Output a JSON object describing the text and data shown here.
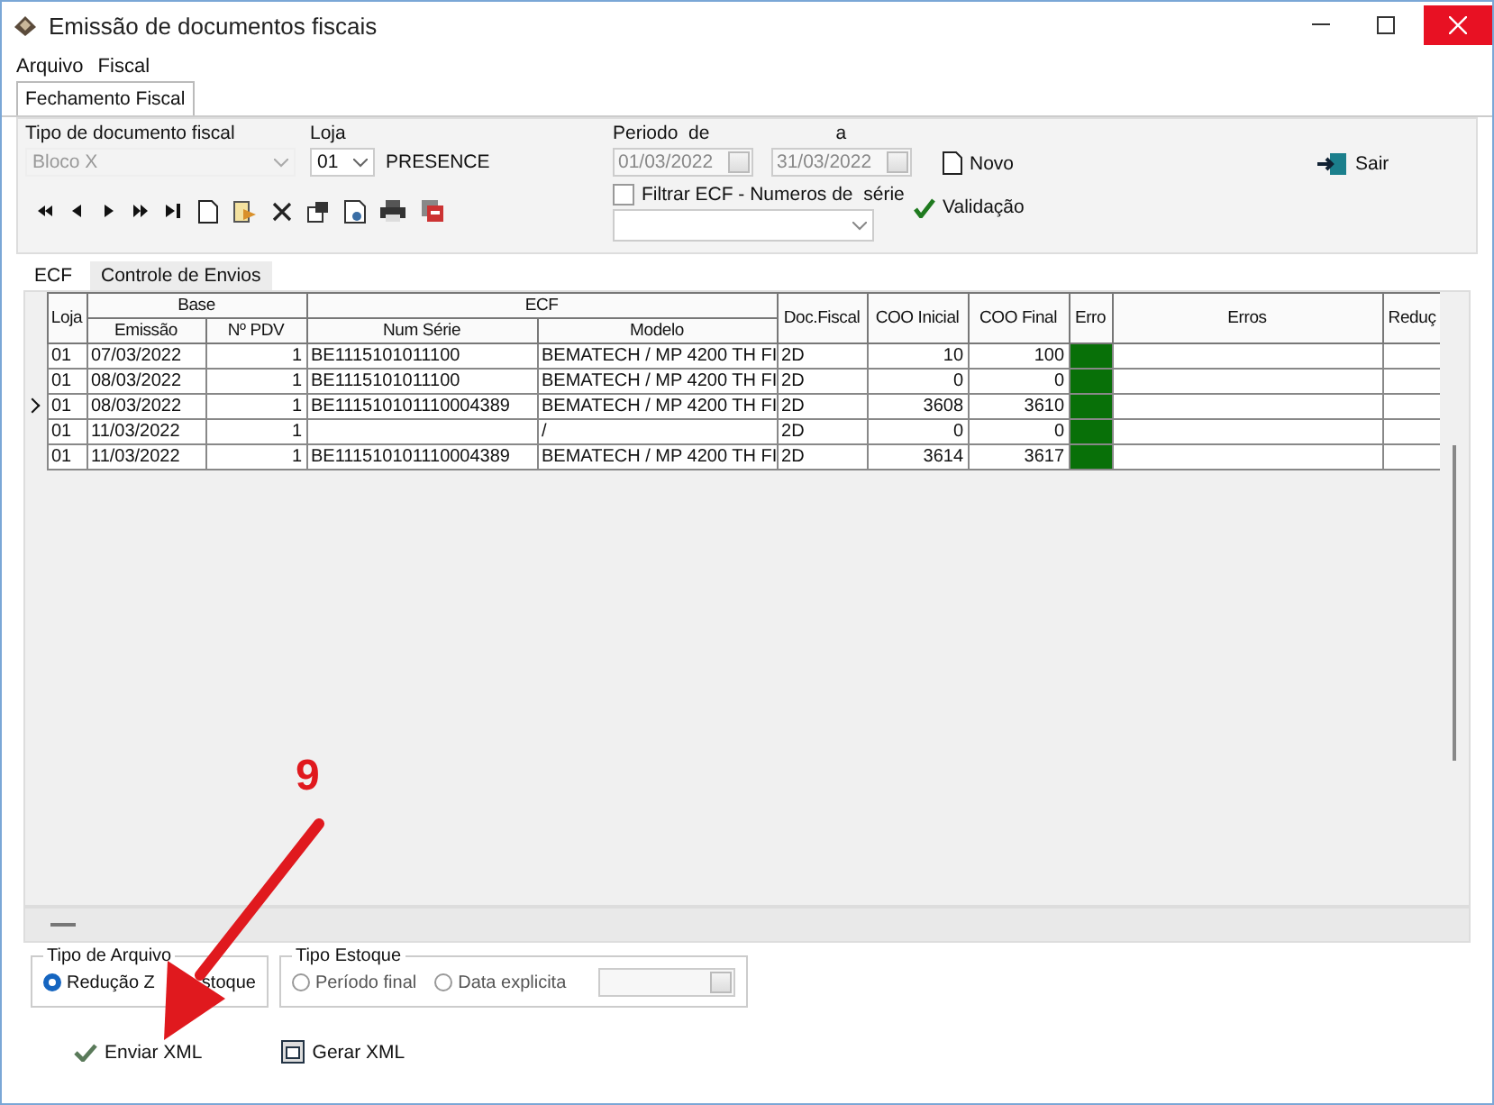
{
  "window": {
    "title": "Emissão de documentos fiscais"
  },
  "menu": [
    "Arquivo",
    "Fiscal"
  ],
  "top_tabs": [
    {
      "label": "Fechamento Fiscal",
      "selected": true
    }
  ],
  "filters": {
    "tipo_label": "Tipo de documento fiscal",
    "tipo_value": "Bloco X",
    "tipo_disabled": true,
    "loja_label": "Loja",
    "loja_value": "01",
    "loja_name": "PRESENCE",
    "periodo_label": "Periodo  de",
    "periodo_from": "01/03/2022",
    "a_label": "a",
    "periodo_to": "31/03/2022",
    "filter_label": "Filtrar ECF - Numeros de  série",
    "filter_checked": false
  },
  "actions": {
    "novo": "Novo",
    "validacao": "Validação",
    "sair": "Sair"
  },
  "tabs": [
    {
      "label": "ECF",
      "selected": true
    },
    {
      "label": "Controle de Envios",
      "selected": false
    }
  ],
  "table": {
    "groups": [
      "Base",
      "ECF"
    ],
    "columns": [
      "Loja",
      "Emissão",
      "Nº PDV",
      "Num Série",
      "Modelo",
      "Doc.Fiscal",
      "COO Inicial",
      "COO Final",
      "Erro",
      "Erros",
      "Reduç"
    ],
    "rows": [
      {
        "selected": false,
        "cells": [
          "01",
          "07/03/2022",
          "1",
          "BE1115101011100",
          "BEMATECH / MP 4200 TH FI",
          "2D",
          "10",
          "100"
        ],
        "color": "#087008"
      },
      {
        "selected": false,
        "cells": [
          "01",
          "08/03/2022",
          "1",
          "BE1115101011100",
          "BEMATECH / MP 4200 TH FI",
          "2D",
          "0",
          "0"
        ],
        "color": "#087008"
      },
      {
        "selected": true,
        "cells": [
          "01",
          "08/03/2022",
          "1",
          "BE111510101110004389",
          "BEMATECH / MP 4200 TH FI",
          "2D",
          "3608",
          "3610"
        ],
        "color": "#087008"
      },
      {
        "selected": false,
        "cells": [
          "01",
          "11/03/2022",
          "1",
          "",
          "/",
          "2D",
          "0",
          "0"
        ],
        "color": "#087008"
      },
      {
        "selected": false,
        "cells": [
          "01",
          "11/03/2022",
          "1",
          "BE111510101110004389",
          "BEMATECH / MP 4200 TH FI",
          "2D",
          "3614",
          "3617"
        ],
        "color": "#087008"
      }
    ]
  },
  "tipo_arquivo": {
    "title": "Tipo de Arquivo",
    "options": [
      {
        "label": "Redução Z",
        "selected": true
      }
    ],
    "covered_label": "stoque"
  },
  "tipo_estoque": {
    "title": "Tipo Estoque",
    "options": [
      {
        "label": "Período final",
        "selected": false
      },
      {
        "label": "Data explicita",
        "selected": false
      }
    ]
  },
  "bottom_buttons": [
    {
      "label": "Enviar XML",
      "kind": "check"
    },
    {
      "label": "Gerar XML",
      "kind": "grid"
    }
  ],
  "annotation": {
    "label": "9"
  }
}
